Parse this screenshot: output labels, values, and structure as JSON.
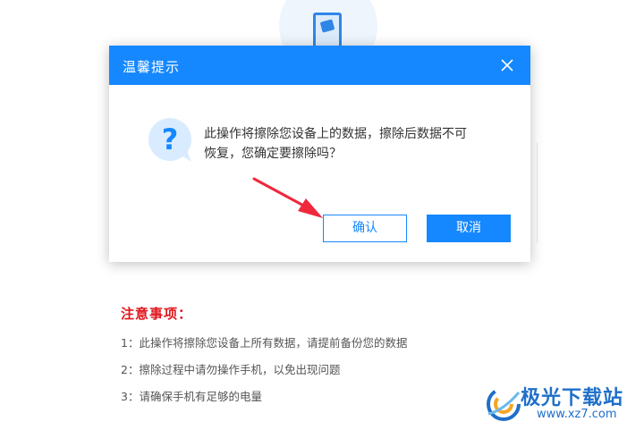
{
  "dialog": {
    "title": "温馨提示",
    "message_line1": "此操作将擦除您设备上的数据，擦除后数据不可",
    "message_line2": "恢复，您确定要擦除吗？",
    "question_glyph": "?",
    "confirm_label": "确认",
    "cancel_label": "取消",
    "close_icon": "close-icon"
  },
  "notes": {
    "title": "注意事项：",
    "items": [
      "1：此操作将擦除您设备上所有数据，请提前备份您的数据",
      "2：擦除过程中请勿操作手机，以免出现问题",
      "3：请确保手机有足够的电量"
    ]
  },
  "watermark": {
    "logo_text": "极光下载站",
    "url": "www.xz7.com"
  },
  "colors": {
    "accent": "#1588ff",
    "warning": "#e0161d",
    "annotation_arrow": "#f0283c"
  }
}
